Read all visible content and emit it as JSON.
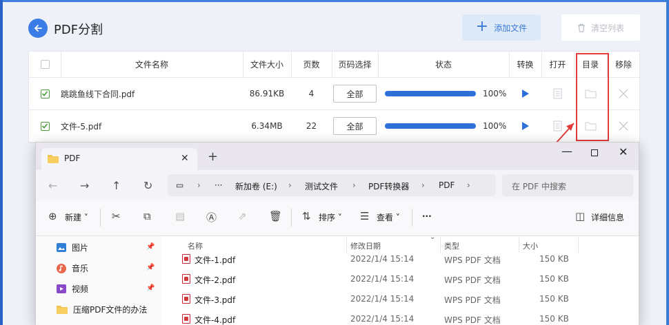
{
  "app": {
    "title": "PDF分割",
    "add_button": "添加文件",
    "clear_button": "清空列表",
    "columns": [
      "文件名称",
      "文件大小",
      "页数",
      "页码选择",
      "状态",
      "转换",
      "打开",
      "目录",
      "移除"
    ],
    "rows": [
      {
        "name": "跳跳鱼线下合同.pdf",
        "size": "86.91KB",
        "pages": "4",
        "page_select": "全部",
        "progress": 1.0,
        "percent": "100%"
      },
      {
        "name": "文件-5.pdf",
        "size": "6.34MB",
        "pages": "22",
        "page_select": "全部",
        "progress": 1.0,
        "percent": "100%"
      }
    ],
    "accent_color": "#3b7ce6",
    "highlight_color": "#e23b3b"
  },
  "explorer": {
    "tab_title": "PDF",
    "breadcrumb": [
      "新加卷 (E:)",
      "测试文件",
      "PDF转换器",
      "PDF"
    ],
    "search_placeholder": "在 PDF 中搜索",
    "toolbar": {
      "new": "新建",
      "sort": "排序",
      "view": "查看",
      "details": "详细信息"
    },
    "nav_items": [
      "图片",
      "音乐",
      "视频",
      "压缩PDF文件的办法"
    ],
    "columns": [
      "名称",
      "修改日期",
      "类型",
      "大小"
    ],
    "files": [
      {
        "name": "文件-1.pdf",
        "date": "2022/1/4 15:14",
        "type": "WPS PDF 文档",
        "size": "150 KB"
      },
      {
        "name": "文件-2.pdf",
        "date": "2022/1/4 15:14",
        "type": "WPS PDF 文档",
        "size": "150 KB"
      },
      {
        "name": "文件-3.pdf",
        "date": "2022/1/4 15:14",
        "type": "WPS PDF 文档",
        "size": "150 KB"
      },
      {
        "name": "文件-4.pdf",
        "date": "2022/1/4 15:14",
        "type": "WPS PDF 文档",
        "size": "150 KB"
      }
    ]
  }
}
